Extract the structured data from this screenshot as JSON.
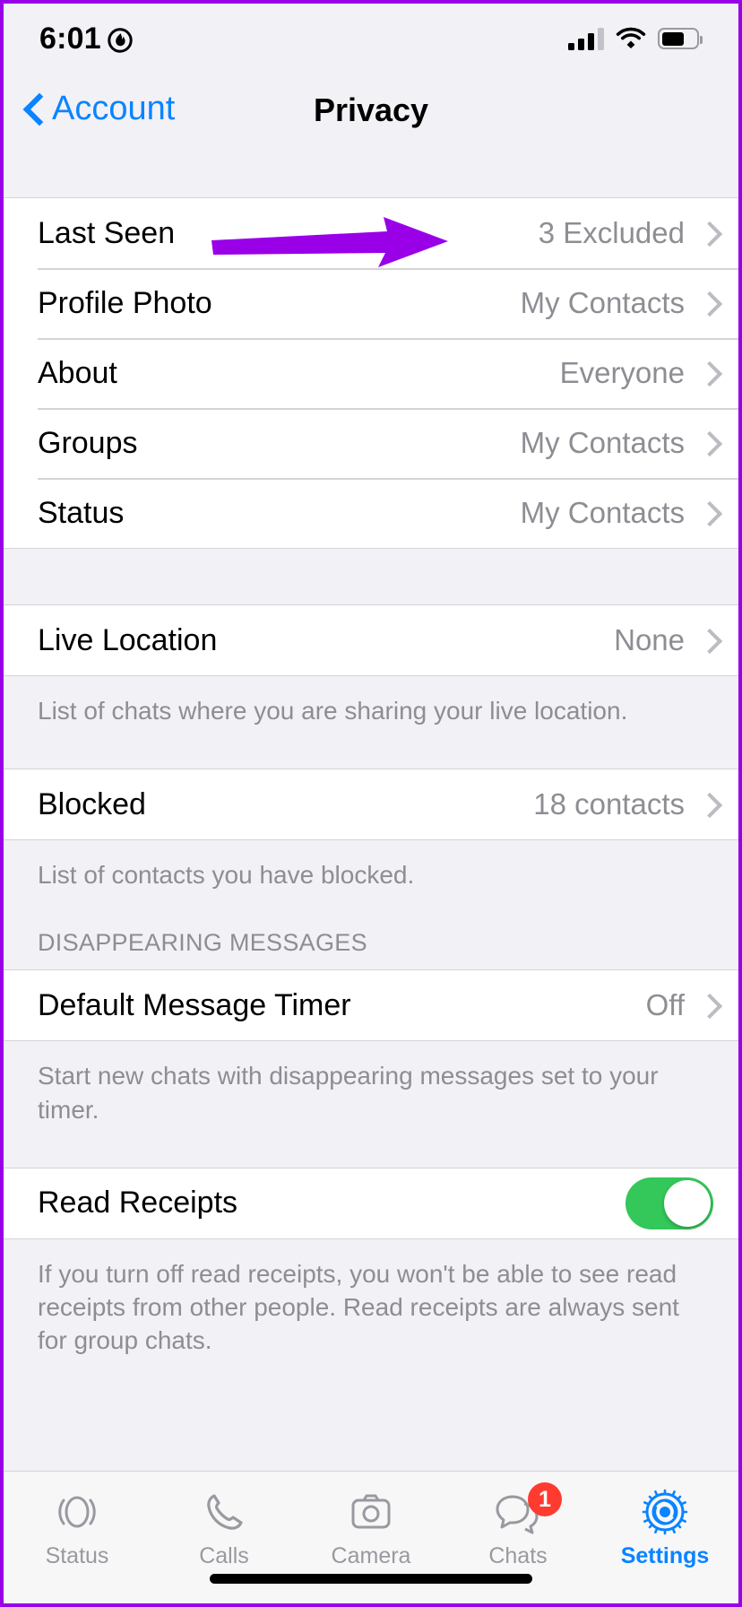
{
  "status_bar": {
    "time": "6:01",
    "flame_icon": "flame-icon",
    "signal_icon": "cellular-signal-icon",
    "wifi_icon": "wifi-icon",
    "battery_icon": "battery-icon"
  },
  "nav": {
    "back_label": "Account",
    "back_icon": "chevron-left-icon",
    "title": "Privacy"
  },
  "privacy_group": {
    "rows": [
      {
        "label": "Last Seen",
        "value": "3 Excluded"
      },
      {
        "label": "Profile Photo",
        "value": "My Contacts"
      },
      {
        "label": "About",
        "value": "Everyone"
      },
      {
        "label": "Groups",
        "value": "My Contacts"
      },
      {
        "label": "Status",
        "value": "My Contacts"
      }
    ]
  },
  "live_location": {
    "label": "Live Location",
    "value": "None",
    "footer": "List of chats where you are sharing your live location."
  },
  "blocked": {
    "label": "Blocked",
    "value": "18 contacts",
    "footer": "List of contacts you have blocked."
  },
  "disappearing": {
    "section_header": "DISAPPEARING MESSAGES",
    "label": "Default Message Timer",
    "value": "Off",
    "footer": "Start new chats with disappearing messages set to your timer."
  },
  "read_receipts": {
    "label": "Read Receipts",
    "toggle_state": "on",
    "footer": "If you turn off read receipts, you won't be able to see read receipts from other people. Read receipts are always sent for group chats."
  },
  "tabbar": {
    "items": [
      {
        "label": "Status",
        "icon": "status-rings-icon",
        "active": false,
        "badge": ""
      },
      {
        "label": "Calls",
        "icon": "phone-icon",
        "active": false,
        "badge": ""
      },
      {
        "label": "Camera",
        "icon": "camera-icon",
        "active": false,
        "badge": ""
      },
      {
        "label": "Chats",
        "icon": "chat-bubbles-icon",
        "active": false,
        "badge": "1"
      },
      {
        "label": "Settings",
        "icon": "gear-icon",
        "active": true,
        "badge": ""
      }
    ]
  },
  "annotation": {
    "type": "arrow",
    "color": "#9900e8",
    "points_to": "3 Excluded",
    "border_color": "#9900e8"
  }
}
